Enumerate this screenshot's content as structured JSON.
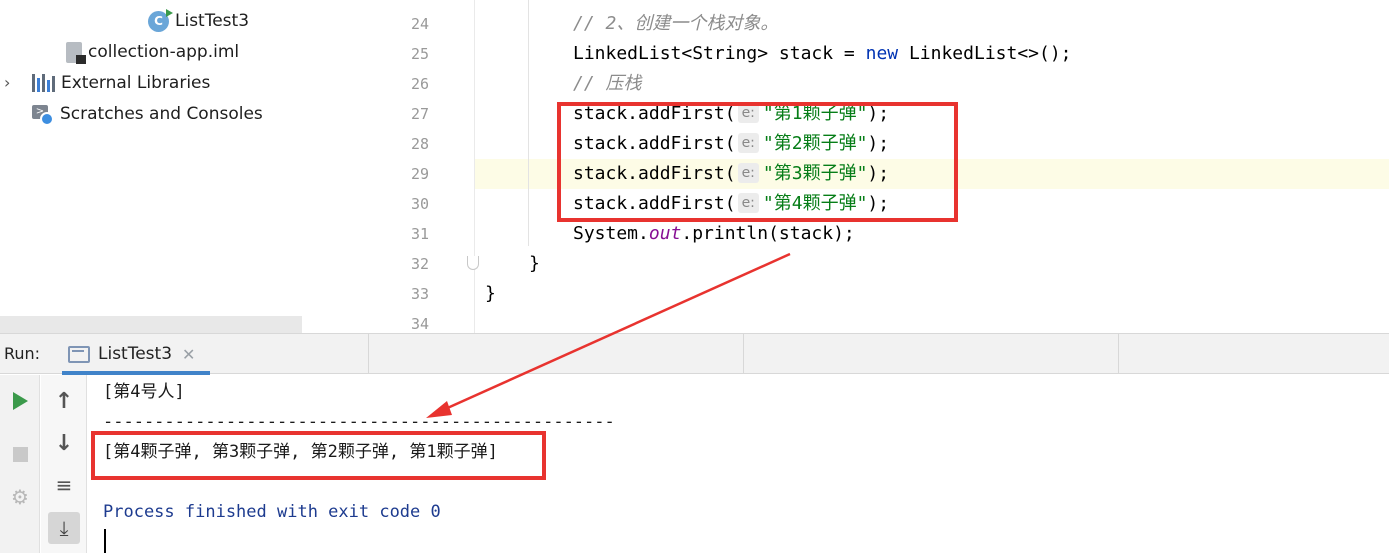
{
  "project_tree": {
    "items": [
      {
        "label": "ListTest3",
        "icon": "java-class-icon",
        "expandable": false
      },
      {
        "label": "collection-app.iml",
        "icon": "module-file-icon",
        "expandable": false
      },
      {
        "label": "External Libraries",
        "icon": "library-icon",
        "expandable": true
      },
      {
        "label": "Scratches and Consoles",
        "icon": "scratches-icon",
        "expandable": false
      }
    ]
  },
  "editor": {
    "line_numbers": [
      "24",
      "25",
      "26",
      "27",
      "28",
      "29",
      "30",
      "31",
      "32",
      "33",
      "34"
    ],
    "current_line": "29",
    "code": {
      "l24": "// 2、创建一个栈对象。",
      "l25_type": "LinkedList<String> stack = ",
      "l25_kw": "new",
      "l25_rest": " LinkedList<>();",
      "l26": "// 压栈",
      "push_call": "stack.addFirst(",
      "param_hint": "e:",
      "push_args": [
        "\"第1颗子弹\"",
        "\"第2颗子弹\"",
        "\"第3颗子弹\"",
        "\"第4颗子弹\""
      ],
      "push_end": ");",
      "l31_a": "System.",
      "l31_field": "out",
      "l31_b": ".println(stack);",
      "l32": "}",
      "l33": "}"
    }
  },
  "run_panel": {
    "label": "Run:",
    "tab_label": "ListTest3",
    "close_glyph": "✕",
    "console_lines": {
      "l1": "[第4号人]",
      "l2": "--------------------------------------------------",
      "l3": "[第4颗子弹, 第3颗子弹, 第2颗子弹, 第1颗子弹]",
      "l4": "Process finished with exit code 0"
    }
  },
  "colors": {
    "annotation_red": "#e8332f",
    "keyword": "#0033b3",
    "string": "#067d17",
    "comment": "#8c8c8c",
    "accent_tab": "#4083c9"
  }
}
